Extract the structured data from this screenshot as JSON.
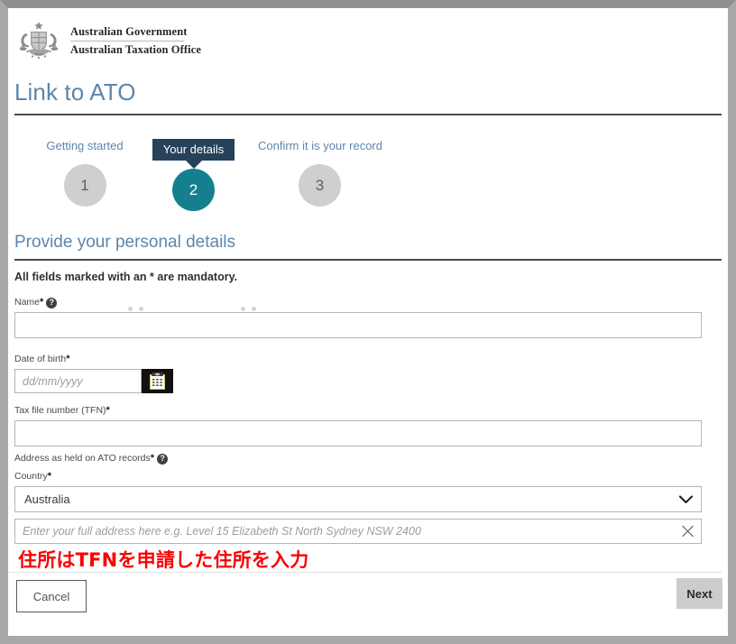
{
  "brand": {
    "crest_icon": "australian-coat-of-arms",
    "line1": "Australian Government",
    "line2": "Australian Taxation Office"
  },
  "page_title": "Link to ATO",
  "stepper": {
    "steps": [
      {
        "label": "Getting started",
        "number": "1",
        "state": "inactive"
      },
      {
        "label": "Your details",
        "number": "2",
        "state": "current"
      },
      {
        "label": "Confirm it is your record",
        "number": "3",
        "state": "inactive"
      }
    ]
  },
  "form": {
    "section_title": "Provide your personal details",
    "mandatory_note": "All fields marked with an * are mandatory.",
    "name": {
      "label": "Name",
      "required_mark": "*",
      "help_icon": "help-circle-icon",
      "help_glyph": "?",
      "value": "",
      "placeholder": ""
    },
    "dob": {
      "label": "Date of birth",
      "required_mark": "*",
      "value": "",
      "placeholder": "dd/mm/yyyy",
      "calendar_icon": "calendar-icon"
    },
    "tfn": {
      "label": "Tax file number (TFN)",
      "required_mark": "*",
      "value": "",
      "placeholder": ""
    },
    "address_group": {
      "label": "Address as held on ATO records",
      "required_mark": "*",
      "help_icon": "help-circle-icon",
      "help_glyph": "?"
    },
    "country": {
      "label": "Country",
      "required_mark": "*",
      "selected": "Australia",
      "options": [
        "Australia"
      ],
      "chevron_icon": "chevron-down-icon"
    },
    "address": {
      "value": "",
      "placeholder": "Enter your full address here e.g. Level 15 Elizabeth St North Sydney NSW 2400",
      "clear_icon": "close-x-icon"
    }
  },
  "annotation": {
    "text": "住所はTFNを申請した住所を入力",
    "color": "#fb0000"
  },
  "actions": {
    "cancel_label": "Cancel",
    "next_label": "Next"
  },
  "colors": {
    "accent_teal": "#15808d",
    "link_blue": "#5d86ab",
    "tooltip_navy": "#26415a",
    "annotation_red": "#fb0000",
    "next_button_gray": "#cccccc"
  }
}
